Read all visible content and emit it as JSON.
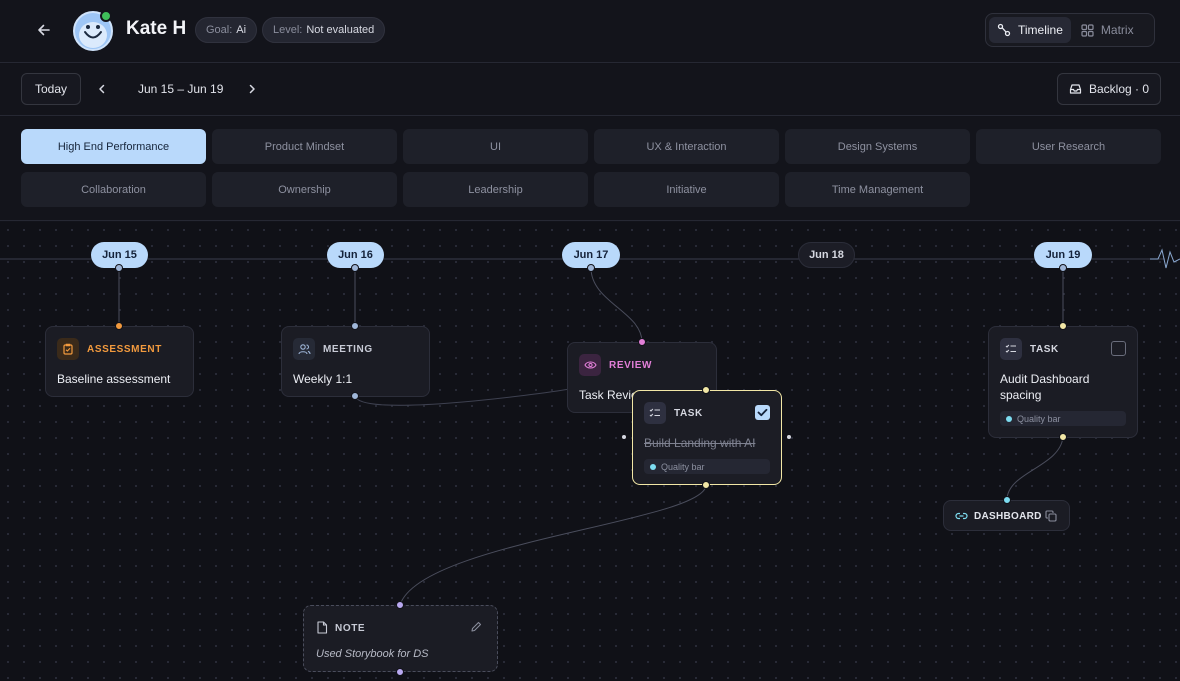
{
  "header": {
    "user_name": "Kate H",
    "goal_label": "Goal:",
    "goal_value": "Ai",
    "level_label": "Level:",
    "level_value": "Not evaluated",
    "views": [
      {
        "label": "Timeline",
        "icon": "timeline-icon",
        "active": true
      },
      {
        "label": "Matrix",
        "icon": "grid-icon",
        "active": false
      }
    ]
  },
  "toolbar": {
    "today_label": "Today",
    "date_range": "Jun 15 – Jun 19",
    "backlog_label": "Backlog · 0"
  },
  "categories": [
    {
      "label": "High End Performance",
      "active": true
    },
    {
      "label": "Product Mindset",
      "active": false
    },
    {
      "label": "UI",
      "active": false
    },
    {
      "label": "UX & Interaction",
      "active": false
    },
    {
      "label": "Design Systems",
      "active": false
    },
    {
      "label": "User Research",
      "active": false
    },
    {
      "label": "Collaboration",
      "active": false
    },
    {
      "label": "Ownership",
      "active": false
    },
    {
      "label": "Leadership",
      "active": false
    },
    {
      "label": "Initiative",
      "active": false
    },
    {
      "label": "Time Management",
      "active": false
    }
  ],
  "timeline": {
    "dates": [
      {
        "label": "Jun 15",
        "has_items": true
      },
      {
        "label": "Jun 16",
        "has_items": true
      },
      {
        "label": "Jun 17",
        "has_items": true
      },
      {
        "label": "Jun 18",
        "has_items": false
      },
      {
        "label": "Jun 19",
        "has_items": true
      }
    ]
  },
  "cards": {
    "assessment": {
      "kind": "ASSESSMENT",
      "title": "Baseline assessment",
      "color": "#f29a3e"
    },
    "meeting": {
      "kind": "MEETING",
      "title": "Weekly 1:1",
      "color": "#9fb6d8"
    },
    "review": {
      "kind": "REVIEW",
      "title": "Task Revie",
      "color": "#e27fd8"
    },
    "task_landing": {
      "kind": "TASK",
      "title": "Build Landing with AI",
      "badge": "Quality bar",
      "checked": true,
      "color": "#f2e7a6"
    },
    "task_audit": {
      "kind": "TASK",
      "title": "Audit Dashboard spacing",
      "badge": "Quality bar",
      "checked": false
    },
    "dashboard": {
      "label": "DASHBOARD"
    },
    "note": {
      "kind": "NOTE",
      "text": "Used Storybook for DS"
    }
  }
}
